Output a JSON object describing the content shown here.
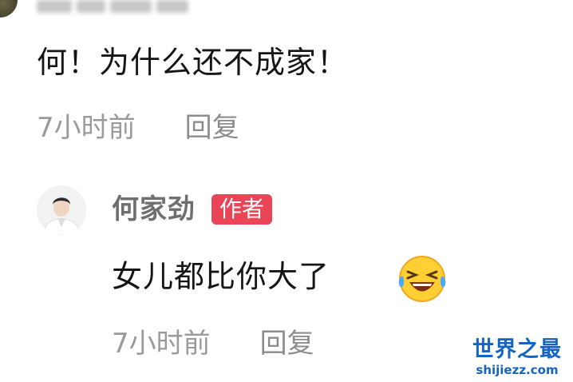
{
  "top_comment": {
    "text": "何！为什么还不成家！",
    "time": "7小时前",
    "reply_label": "回复"
  },
  "author_reply": {
    "name": "何家劲",
    "badge": "作者",
    "text": "女儿都比你大了",
    "emoji": "laughing-with-tears-emoji",
    "time": "7小时前",
    "reply_label": "回复"
  },
  "watermark": {
    "title": "世界之最",
    "url": "shijiezz.com"
  },
  "colors": {
    "text": "#151515",
    "meta": "#9a9a9a",
    "author_name": "#6f6f6f",
    "badge_bg": "#e94557",
    "watermark": "#1565c0"
  }
}
